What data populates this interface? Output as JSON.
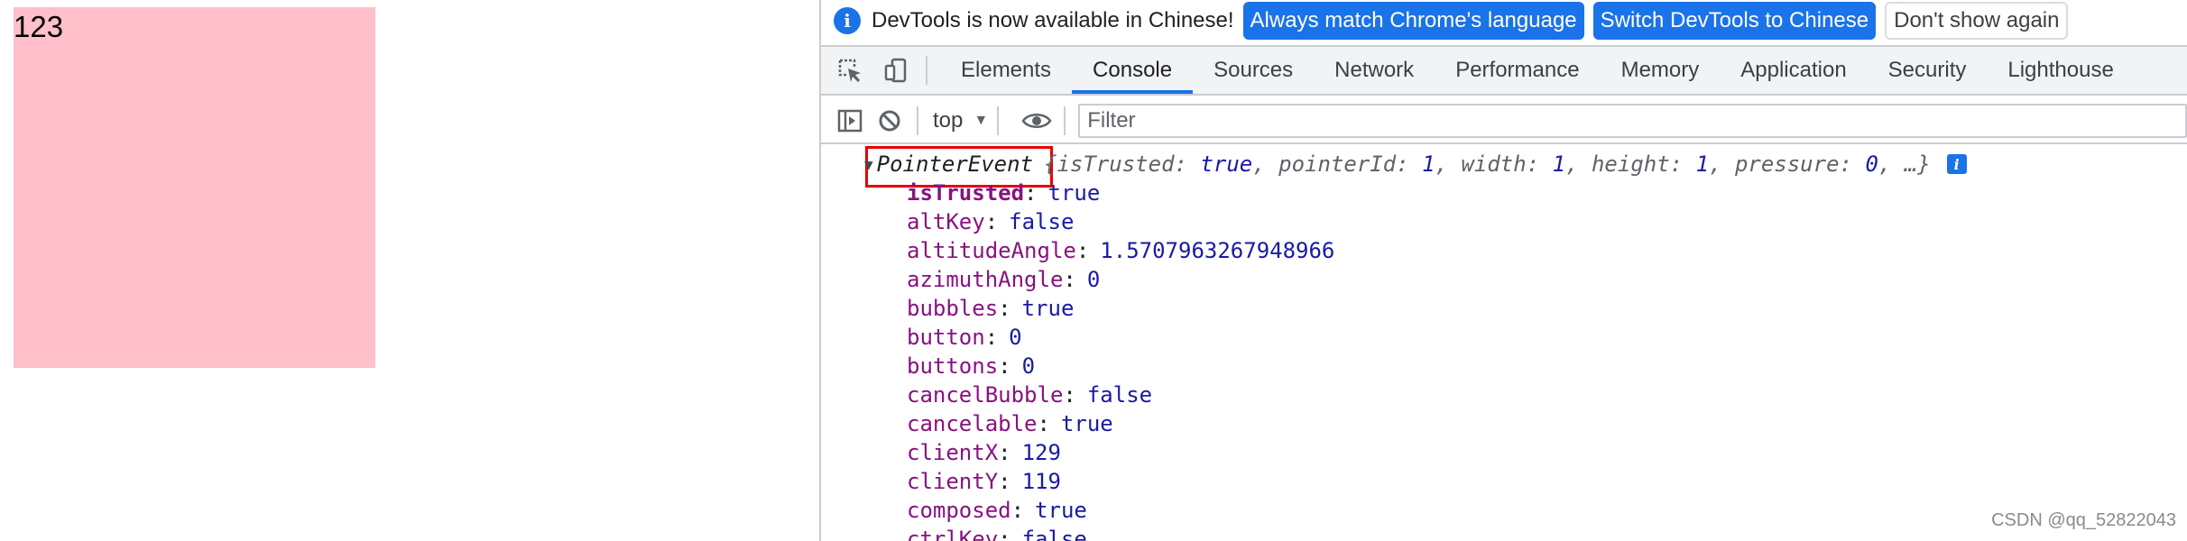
{
  "page": {
    "box_text": "123",
    "box_color": "#ffc0cb"
  },
  "infobar": {
    "message": "DevTools is now available in Chinese!",
    "buttons": [
      "Always match Chrome's language",
      "Switch DevTools to Chinese",
      "Don't show again"
    ]
  },
  "tabs": [
    "Elements",
    "Console",
    "Sources",
    "Network",
    "Performance",
    "Memory",
    "Application",
    "Security",
    "Lighthouse"
  ],
  "active_tab": "Console",
  "toolbar": {
    "context": "top",
    "filter_placeholder": "Filter"
  },
  "console": {
    "summary_class": "PointerEvent",
    "preview": [
      {
        "k": "isTrusted",
        "v": "true"
      },
      {
        "k": "pointerId",
        "v": "1"
      },
      {
        "k": "width",
        "v": "1"
      },
      {
        "k": "height",
        "v": "1"
      },
      {
        "k": "pressure",
        "v": "0"
      }
    ],
    "preview_end": ", …}",
    "properties": [
      {
        "key": "isTrusted",
        "value": "true"
      },
      {
        "key": "altKey",
        "value": "false"
      },
      {
        "key": "altitudeAngle",
        "value": "1.5707963267948966"
      },
      {
        "key": "azimuthAngle",
        "value": "0"
      },
      {
        "key": "bubbles",
        "value": "true"
      },
      {
        "key": "button",
        "value": "0"
      },
      {
        "key": "buttons",
        "value": "0"
      },
      {
        "key": "cancelBubble",
        "value": "false"
      },
      {
        "key": "cancelable",
        "value": "true"
      },
      {
        "key": "clientX",
        "value": "129"
      },
      {
        "key": "clientY",
        "value": "119"
      },
      {
        "key": "composed",
        "value": "true"
      },
      {
        "key": "ctrlKey",
        "value": "false"
      }
    ]
  },
  "watermark": "CSDN @qq_52822043",
  "colors": {
    "accent": "#1a73e8",
    "highlight_box": "#e60000"
  }
}
